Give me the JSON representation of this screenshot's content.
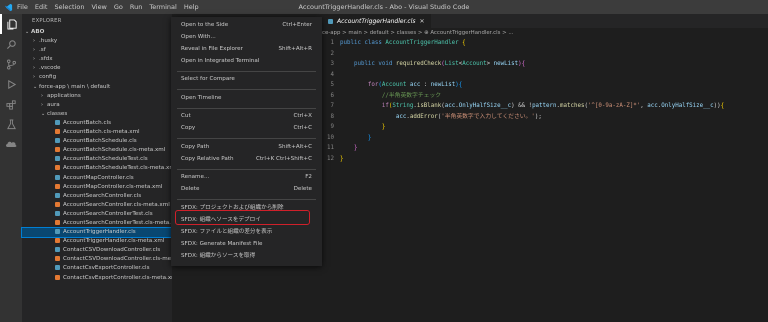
{
  "titlebar": {
    "menus": [
      "File",
      "Edit",
      "Selection",
      "View",
      "Go",
      "Run",
      "Terminal",
      "Help"
    ],
    "title": "AccountTriggerHandler.cls - Abo - Visual Studio Code"
  },
  "activity_icons": [
    "explorer-icon",
    "search-icon",
    "source-control-icon",
    "run-debug-icon",
    "extensions-icon",
    "testing-icon",
    "salesforce-icon"
  ],
  "sidebar": {
    "title": "EXPLORER",
    "root": "ABO",
    "items": [
      {
        "label": "ABO",
        "depth": 0,
        "type": "folder-open"
      },
      {
        "label": ".husky",
        "depth": 1,
        "type": "folder"
      },
      {
        "label": ".sf",
        "depth": 1,
        "type": "folder"
      },
      {
        "label": ".sfdx",
        "depth": 1,
        "type": "folder"
      },
      {
        "label": ".vscode",
        "depth": 1,
        "type": "folder"
      },
      {
        "label": "config",
        "depth": 1,
        "type": "folder"
      },
      {
        "label": "force-app \\ main \\ default",
        "depth": 1,
        "type": "folder-open"
      },
      {
        "label": "applications",
        "depth": 2,
        "type": "folder"
      },
      {
        "label": "aura",
        "depth": 2,
        "type": "folder"
      },
      {
        "label": "classes",
        "depth": 2,
        "type": "folder-open"
      },
      {
        "label": "AccountBatch.cls",
        "depth": 3,
        "type": "cls"
      },
      {
        "label": "AccountBatch.cls-meta.xml",
        "depth": 3,
        "type": "xml"
      },
      {
        "label": "AccountBatchSchedule.cls",
        "depth": 3,
        "type": "cls"
      },
      {
        "label": "AccountBatchSchedule.cls-meta.xml",
        "depth": 3,
        "type": "xml"
      },
      {
        "label": "AccountBatchScheduleTest.cls",
        "depth": 3,
        "type": "cls"
      },
      {
        "label": "AccountBatchScheduleTest.cls-meta.xml",
        "depth": 3,
        "type": "xml"
      },
      {
        "label": "AccountMapController.cls",
        "depth": 3,
        "type": "cls"
      },
      {
        "label": "AccountMapController.cls-meta.xml",
        "depth": 3,
        "type": "xml"
      },
      {
        "label": "AccountSearchController.cls",
        "depth": 3,
        "type": "cls"
      },
      {
        "label": "AccountSearchController.cls-meta.xml",
        "depth": 3,
        "type": "xml"
      },
      {
        "label": "AccountSearchControllerTest.cls",
        "depth": 3,
        "type": "cls"
      },
      {
        "label": "AccountSearchControllerTest.cls-meta.xml",
        "depth": 3,
        "type": "xml"
      },
      {
        "label": "AccountTriggerHandler.cls",
        "depth": 3,
        "type": "cls",
        "selected": true
      },
      {
        "label": "AccountTriggerHandler.cls-meta.xml",
        "depth": 3,
        "type": "xml"
      },
      {
        "label": "ContactCSVDownloadController.cls",
        "depth": 3,
        "type": "cls"
      },
      {
        "label": "ContactCSVDownloadController.cls-meta.xml",
        "depth": 3,
        "type": "xml"
      },
      {
        "label": "ContactCsvExportController.cls",
        "depth": 3,
        "type": "cls"
      },
      {
        "label": "ContactCsvExportController.cls-meta.xml",
        "depth": 3,
        "type": "xml"
      }
    ]
  },
  "editor": {
    "tab": "AccountTriggerHandler.cls",
    "breadcrumb": "ce-app > main > default > classes > ⊕ AccountTriggerHandler.cls > ...",
    "line_numbers": [
      "1",
      "2",
      "3",
      "4",
      "5",
      "6",
      "7",
      "8",
      "9",
      "10",
      "11",
      "12"
    ]
  },
  "context_menu": {
    "items": [
      {
        "label": "Open to the Side",
        "key": "Ctrl+Enter"
      },
      {
        "label": "Open With...",
        "key": ""
      },
      {
        "label": "Reveal in File Explorer",
        "key": "Shift+Alt+R"
      },
      {
        "label": "Open in Integrated Terminal",
        "key": ""
      },
      {
        "label": "Select for Compare",
        "key": ""
      },
      {
        "label": "Open Timeline",
        "key": ""
      },
      {
        "label": "Cut",
        "key": "Ctrl+X"
      },
      {
        "label": "Copy",
        "key": "Ctrl+C"
      },
      {
        "label": "Copy Path",
        "key": "Shift+Alt+C"
      },
      {
        "label": "Copy Relative Path",
        "key": "Ctrl+K Ctrl+Shift+C"
      },
      {
        "label": "Rename...",
        "key": "F2"
      },
      {
        "label": "Delete",
        "key": "Delete"
      },
      {
        "label": "SFDX: プロジェクトおよび組織から削除",
        "key": ""
      },
      {
        "label": "SFDX: 組織へソースをデプロイ",
        "key": ""
      },
      {
        "label": "SFDX: ファイルと組織の差分を表示",
        "key": ""
      },
      {
        "label": "SFDX: Generate Manifest File",
        "key": ""
      },
      {
        "label": "SFDX: 組織からソースを取得",
        "key": ""
      }
    ]
  },
  "colors": {
    "highlight": "#d0202a",
    "selection": "#094771",
    "accent": "#007acc"
  }
}
